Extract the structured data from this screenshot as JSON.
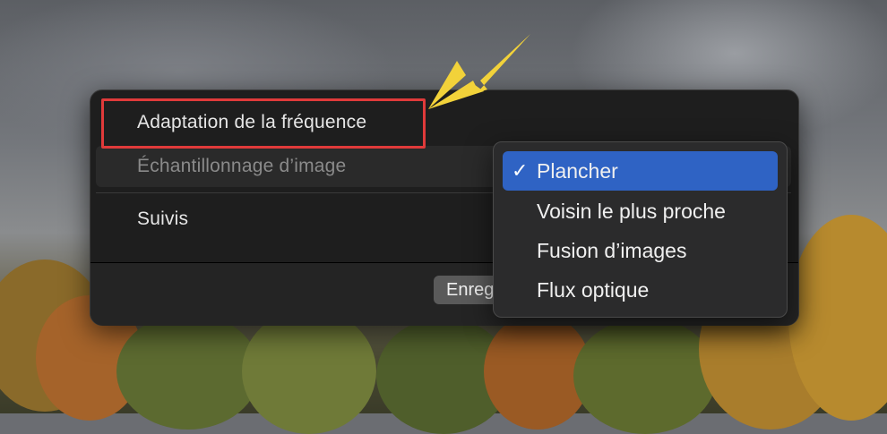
{
  "settings": {
    "frame_rate_adaptation": "Adaptation de la fréquence",
    "frame_sampling": "Échantillonnage d’image",
    "tracking": "Suivis",
    "save_button": "Enreg"
  },
  "popup_menu": {
    "items": [
      {
        "label": "Plancher",
        "selected": true
      },
      {
        "label": "Voisin le plus proche",
        "selected": false
      },
      {
        "label": "Fusion d’images",
        "selected": false
      },
      {
        "label": "Flux optique",
        "selected": false
      }
    ],
    "check_glyph": "✓"
  },
  "colors": {
    "highlight_box": "#e03a3a",
    "arrow": "#f2d23a",
    "selection": "#2f63c4"
  }
}
